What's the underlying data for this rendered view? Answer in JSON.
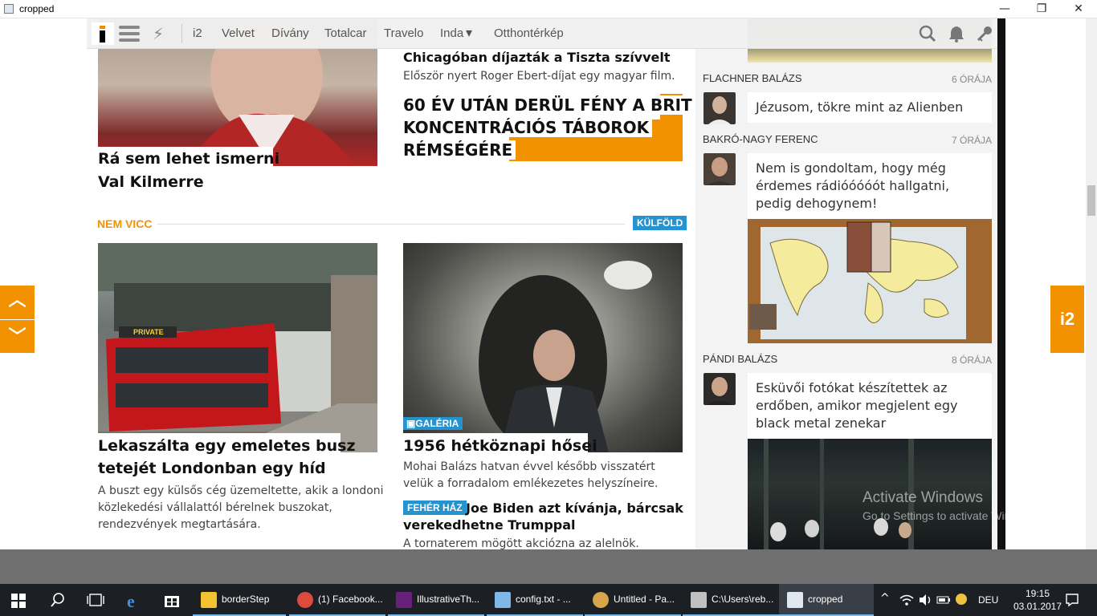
{
  "window": {
    "title": "cropped",
    "minimize": "—",
    "maximize": "❐",
    "close": "✕"
  },
  "nav": {
    "links": [
      "i2",
      "Velvet",
      "Dívány",
      "Totalcar",
      "Travelo",
      "Inda",
      "Otthontérkép"
    ],
    "inda_caret": "▾"
  },
  "articles": {
    "val_kilmer": {
      "title_line1": "Rá sem lehet ismerni",
      "title_line2": "Val Kilmerre"
    },
    "chicago": {
      "title": "Chicagóban díjazták a Tiszta szívvelt",
      "lead": "Először nyert Roger Ebert-díjat egy magyar film."
    },
    "brit": {
      "line1": "60 ÉV UTÁN DERÜL FÉNY A BRIT",
      "line2": "KONCENTRÁCIÓS TÁBOROK",
      "line3": "RÉMSÉGÉRE"
    },
    "section": {
      "title": "NEM VICC",
      "tag": "KÜLFÖLD"
    },
    "bus": {
      "title_line1": "Lekaszálta egy emeletes busz",
      "title_line2": "tetejét Londonban egy híd",
      "lead": "A buszt egy külsős cég üzemeltette, akik a londoni közlekedési vállalattól bérelnek buszokat, rendezvények megtartására.",
      "bus_sign": "PRIVATE"
    },
    "heroes": {
      "badge": "GALÉRIA",
      "title": "1956 hétköznapi hősei",
      "lead": "Mohai Balázs hatvan évvel később visszatért velük a forradalom emlékezetes helyszíneire."
    },
    "biden": {
      "tag": "FEHÉR HÁZ",
      "title_part1": "Joe Biden azt kívánja, bárcsak",
      "title_part2": "verekedhetne Trumppal",
      "lead": "A tornaterem mögött akciózna az alelnök."
    }
  },
  "sidebar": {
    "posts": [
      {
        "author": "FLACHNER BALÁZS",
        "time": "6 ÓRÁJA",
        "text": "Jézusom, tökre mint az Alienben"
      },
      {
        "author": "BAKRÓ-NAGY FERENC",
        "time": "7 ÓRÁJA",
        "text": "Nem is gondoltam, hogy még érdemes rádióóóóót hallgatni, pedig dehogynem!"
      },
      {
        "author": "PÁNDI BALÁZS",
        "time": "8 ÓRÁJA",
        "text": "Esküvői fotókat készítettek az erdőben, amikor megjelent egy black metal zenekar"
      }
    ]
  },
  "side_buttons": {
    "up": "︿",
    "down": "﹀",
    "i2": "i2"
  },
  "watermark": {
    "line1": "Activate Windows",
    "line2": "Go to Settings to activate Windows."
  },
  "taskbar": {
    "items": [
      {
        "label": "borderStep",
        "color": "#f2c230"
      },
      {
        "label": "(1) Facebook...",
        "color": "#dd4b3e"
      },
      {
        "label": "IllustrativeTh...",
        "color": "#68217a"
      },
      {
        "label": "config.txt - ...",
        "color": "#7fb8e6"
      },
      {
        "label": "Untitled - Pa...",
        "color": "#d8a64a"
      },
      {
        "label": "C:\\Users\\reb...",
        "color": "#c0c0c0"
      },
      {
        "label": "cropped",
        "color": "#dfe8f0"
      }
    ],
    "lang": "DEU",
    "time": "19:15",
    "date": "03.01.2017"
  },
  "colors": {
    "accent": "#f39200",
    "section_blue": "#2493cf",
    "taskbar": "#1c1f24"
  }
}
